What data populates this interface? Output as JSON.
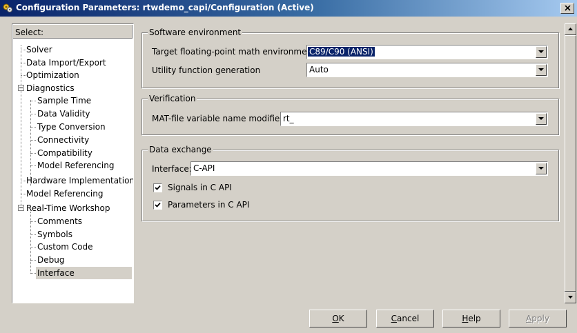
{
  "window": {
    "title": "Configuration Parameters: rtwdemo_capi/Configuration (Active)"
  },
  "tree": {
    "header": "Select:",
    "items": [
      {
        "label": "Solver",
        "selected": false
      },
      {
        "label": "Data Import/Export",
        "selected": false
      },
      {
        "label": "Optimization",
        "selected": false
      },
      {
        "label": "Diagnostics",
        "selected": false,
        "expanded": true
      },
      {
        "label": "Sample Time",
        "selected": false
      },
      {
        "label": "Data Validity",
        "selected": false
      },
      {
        "label": "Type Conversion",
        "selected": false
      },
      {
        "label": "Connectivity",
        "selected": false
      },
      {
        "label": "Compatibility",
        "selected": false
      },
      {
        "label": "Model Referencing",
        "selected": false
      },
      {
        "label": "Hardware Implementation",
        "selected": false
      },
      {
        "label": "Model Referencing",
        "selected": false
      },
      {
        "label": "Real-Time Workshop",
        "selected": false,
        "expanded": true
      },
      {
        "label": "Comments",
        "selected": false
      },
      {
        "label": "Symbols",
        "selected": false
      },
      {
        "label": "Custom Code",
        "selected": false
      },
      {
        "label": "Debug",
        "selected": false
      },
      {
        "label": "Interface",
        "selected": true
      }
    ]
  },
  "software_env": {
    "title": "Software environment",
    "math_label": "Target floating-point math environment:",
    "math_value": "C89/C90 (ANSI)",
    "utility_label": "Utility function generation",
    "utility_value": "Auto"
  },
  "verification": {
    "title": "Verification",
    "mat_label": "MAT-file variable name modifier:",
    "mat_value": "rt_"
  },
  "data_exchange": {
    "title": "Data exchange",
    "interface_label": "Interface:",
    "interface_value": "C-API",
    "signals_label": "Signals in C API",
    "signals_checked": true,
    "params_label": "Parameters in C API",
    "params_checked": true
  },
  "buttons": {
    "ok": {
      "mnemonic": "O",
      "rest": "K"
    },
    "cancel": {
      "mnemonic": "C",
      "rest": "ancel"
    },
    "help": {
      "mnemonic": "H",
      "rest": "elp"
    },
    "apply": {
      "mnemonic": "A",
      "rest": "pply",
      "disabled": true
    }
  },
  "colors": {
    "selection": "#0a246a",
    "face": "#d4d0c8"
  }
}
